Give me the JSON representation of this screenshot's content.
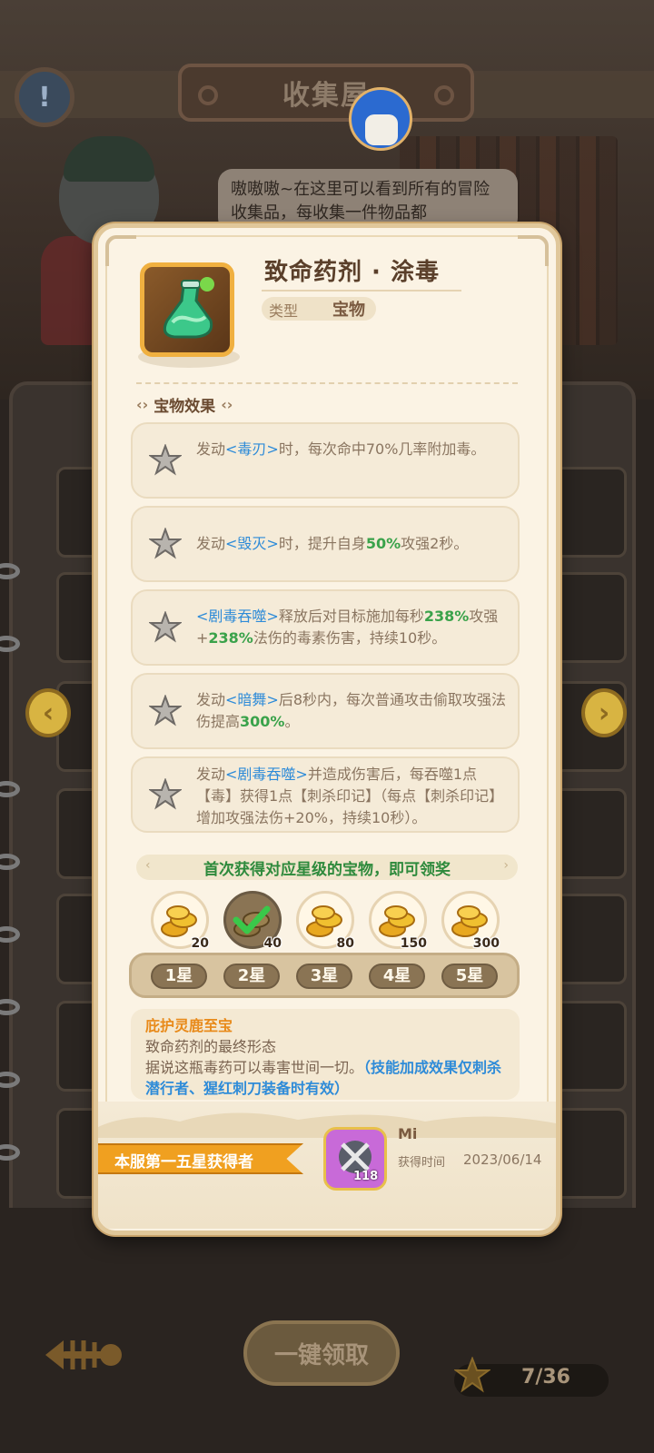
{
  "background": {
    "title": "收集屋",
    "info_icon": "exclamation-icon",
    "npc_speech": "嗷嗷嗷~在这里可以看到所有的冒险收集品，每收集一件物品都",
    "claim_all_label": "一键领取",
    "progress_text": "7/36"
  },
  "item": {
    "name": "致命药剂 · 涂毒",
    "type_label": "类型",
    "type_value": "宝物",
    "icon": "poison-potion-icon"
  },
  "effects_section": {
    "title": "宝物效果",
    "effects": [
      {
        "pre": "发动",
        "kw": "<毒刃>",
        "post": "时，每次命中70%几率附加毒。"
      },
      {
        "pre": "发动",
        "kw": "<毁灭>",
        "mid": "时，提升自身",
        "num": "50%",
        "post": "攻强2秒。"
      },
      {
        "kw": "<剧毒吞噬>",
        "mid": "释放后对目标施加每秒",
        "num": "238%",
        "mid2": "攻强+",
        "num2": "238%",
        "post": "法伤的毒素伤害，持续10秒。"
      },
      {
        "pre": "发动",
        "kw": "<暗舞>",
        "mid": "后8秒内，每次普通攻击偷取攻强法伤提高",
        "num": "300%",
        "post": "。"
      },
      {
        "pre": "发动",
        "kw": "<剧毒吞噬>",
        "post": "并造成伤害后，每吞噬1点【毒】获得1点【刺杀印记】（每点【刺杀印记】增加攻强法伤+20%，持续10秒）。"
      }
    ]
  },
  "rewards": {
    "banner": "首次获得对应星级的宝物，即可领奖",
    "tiers": [
      {
        "star_label": "1星",
        "amount": "20",
        "claimed": false
      },
      {
        "star_label": "2星",
        "amount": "40",
        "claimed": true
      },
      {
        "star_label": "3星",
        "amount": "80",
        "claimed": false
      },
      {
        "star_label": "4星",
        "amount": "150",
        "claimed": false
      },
      {
        "star_label": "5星",
        "amount": "300",
        "claimed": false
      }
    ]
  },
  "description": {
    "title": "庇护灵鹿至宝",
    "line1": "致命药剂的最终形态",
    "line2_plain": "据说这瓶毒药可以毒害世间一切。",
    "line2_blue": "（技能加成效果仅刺杀潜行者、猩红刺刀装备时有效）"
  },
  "first_owner": {
    "banner": "本服第一五星获得者",
    "player_name": "Mi",
    "player_level": "118",
    "obtained_label": "获得时间",
    "obtained_date": "2023/06/14"
  },
  "colors": {
    "keyword_blue": "#2e8bd8",
    "number_green": "#3aa24a",
    "accent_orange": "#f0a020",
    "card_bg": "#fbf3e4"
  }
}
